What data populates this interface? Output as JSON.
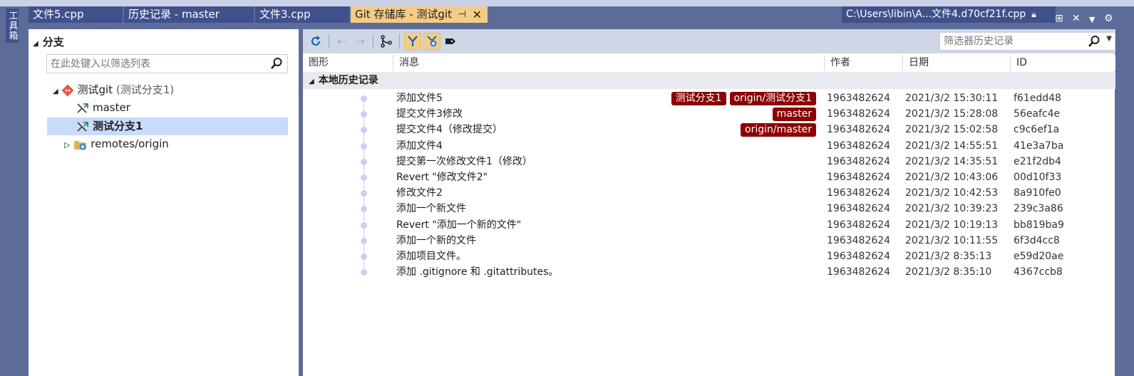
{
  "sidebar": {
    "toolbox_label": "工具箱"
  },
  "tabs": [
    {
      "label": "文件5.cpp"
    },
    {
      "label": "历史记录 - master"
    },
    {
      "label": "文件3.cpp"
    },
    {
      "label": "Git 存储库 - 测试git",
      "active": true,
      "pin_icon": "pin-icon",
      "close_icon": "close-icon"
    }
  ],
  "preview_tab": {
    "label": "C:\\Users\\libin\\A...文件4.d70cf21f.cpp"
  },
  "branches_panel": {
    "title": "分支",
    "filter_placeholder": "在此处键入以筛选列表",
    "repo": {
      "name": "测试git",
      "current_branch": "(测试分支1)"
    },
    "branches": [
      {
        "name": "master"
      },
      {
        "name": "测试分支1",
        "selected": true
      }
    ],
    "remotes": {
      "name": "remotes/origin"
    }
  },
  "history_panel": {
    "filter_placeholder": "筛选器历史记录",
    "columns": {
      "graph": "图形",
      "message": "消息",
      "author": "作者",
      "date": "日期",
      "id": "ID"
    },
    "group_label": "本地历史记录",
    "commits": [
      {
        "message": "添加文件5",
        "tags": [
          "测试分支1",
          "origin/测试分支1"
        ],
        "author": "1963482624",
        "date": "2021/3/2 15:30:11",
        "id": "f61edd48"
      },
      {
        "message": "提交文件3修改",
        "tags": [
          "master"
        ],
        "author": "1963482624",
        "date": "2021/3/2 15:28:08",
        "id": "56eafc4e"
      },
      {
        "message": "提交文件4（修改提交）",
        "tags": [
          "origin/master"
        ],
        "author": "1963482624",
        "date": "2021/3/2 15:02:58",
        "id": "c9c6ef1a"
      },
      {
        "message": "添加文件4",
        "tags": [],
        "author": "1963482624",
        "date": "2021/3/2 14:55:51",
        "id": "41e3a7ba"
      },
      {
        "message": "提交第一次修改文件1（修改）",
        "tags": [],
        "author": "1963482624",
        "date": "2021/3/2 14:35:51",
        "id": "e21f2db4"
      },
      {
        "message": "Revert \"修改文件2\"",
        "tags": [],
        "author": "1963482624",
        "date": "2021/3/2 10:43:06",
        "id": "00d10f33"
      },
      {
        "message": "修改文件2",
        "tags": [],
        "author": "1963482624",
        "date": "2021/3/2 10:42:53",
        "id": "8a910fe0"
      },
      {
        "message": "添加一个新文件",
        "tags": [],
        "author": "1963482624",
        "date": "2021/3/2 10:39:23",
        "id": "239c3a86"
      },
      {
        "message": "Revert \"添加一个新的文件\"",
        "tags": [],
        "author": "1963482624",
        "date": "2021/3/2 10:19:13",
        "id": "bb819ba9"
      },
      {
        "message": "添加一个新的文件",
        "tags": [],
        "author": "1963482624",
        "date": "2021/3/2 10:11:55",
        "id": "6f3d4cc8"
      },
      {
        "message": "添加项目文件。",
        "tags": [],
        "author": "1963482624",
        "date": "2021/3/2 8:35:13",
        "id": "e59d20ae"
      },
      {
        "message": "添加 .gitignore 和 .gitattributes。",
        "tags": [],
        "author": "1963482624",
        "date": "2021/3/2 8:35:10",
        "id": "4367ccb8"
      }
    ]
  },
  "colors": {
    "tag_bg": "#8b0000",
    "active_tab": "#f5cc84",
    "frame": "#5d6b99",
    "selected_row": "#c9dbfa"
  }
}
